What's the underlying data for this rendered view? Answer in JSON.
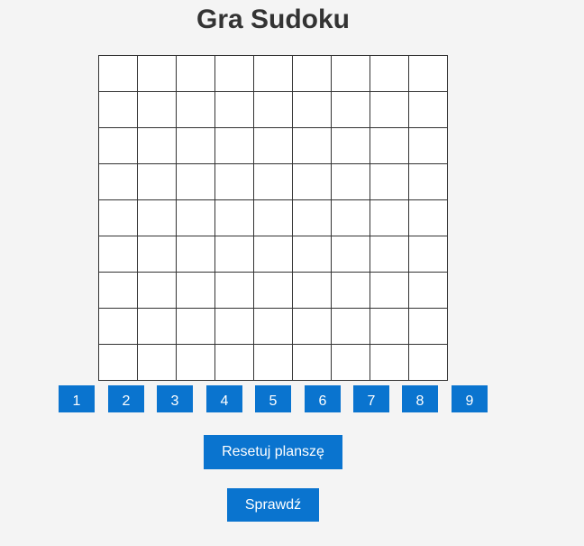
{
  "title": "Gra Sudoku",
  "board": {
    "cells": [
      "",
      "",
      "",
      "",
      "",
      "",
      "",
      "",
      "",
      "",
      "",
      "",
      "",
      "",
      "",
      "",
      "",
      "",
      "",
      "",
      "",
      "",
      "",
      "",
      "",
      "",
      "",
      "",
      "",
      "",
      "",
      "",
      "",
      "",
      "",
      "",
      "",
      "",
      "",
      "",
      "",
      "",
      "",
      "",
      "",
      "",
      "",
      "",
      "",
      "",
      "",
      "",
      "",
      "",
      "",
      "",
      "",
      "",
      "",
      "",
      "",
      "",
      "",
      "",
      "",
      "",
      "",
      "",
      "",
      "",
      "",
      "",
      "",
      "",
      "",
      "",
      "",
      "",
      "",
      "",
      ""
    ]
  },
  "number_buttons": [
    "1",
    "2",
    "3",
    "4",
    "5",
    "6",
    "7",
    "8",
    "9"
  ],
  "actions": {
    "reset_label": "Resetuj planszę",
    "check_label": "Sprawdź"
  },
  "colors": {
    "accent": "#0a74cf",
    "background": "#f4f4f4",
    "grid_line": "#333333"
  }
}
